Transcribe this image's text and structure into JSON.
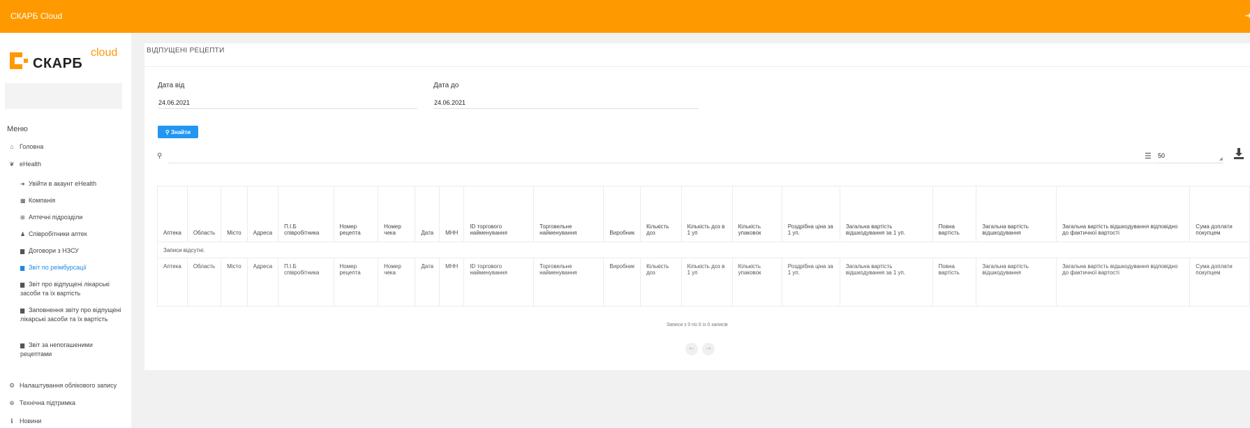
{
  "topbar": {
    "app_title": "СКАРБ Cloud"
  },
  "logo": {
    "word": "СКАРБ",
    "cloud": "cloud"
  },
  "sidebar": {
    "menu_title": "Меню",
    "items": [
      {
        "label": "Головна",
        "icon": "home-icon"
      },
      {
        "label": "eHealth",
        "icon": "leaf-icon"
      }
    ],
    "sub_items": [
      {
        "label": "Увійти в акаунт eHealth",
        "icon": "sign-in-icon"
      },
      {
        "label": "Компанія",
        "icon": "building-icon"
      },
      {
        "label": "Аптечні підрозділи",
        "icon": "plus-square-icon"
      },
      {
        "label": "Співробітники аптек",
        "icon": "users-icon"
      },
      {
        "label": "Договори з НЗСУ",
        "icon": "file-icon"
      },
      {
        "label": "Звіт по реімбурсації",
        "icon": "file-icon",
        "active": true
      },
      {
        "label": "Звіт про відпущені лікарські засоби та їх вартість",
        "icon": "file-icon"
      },
      {
        "label": "Заповнення звіту про відпущені лікарські засоби та їх вартість",
        "icon": "file-icon"
      },
      {
        "label": "Звіт за непогашеними рецептами",
        "icon": "file-icon"
      }
    ],
    "bottom_items": [
      {
        "label": "Налаштування облікового запису",
        "icon": "gear-icon"
      },
      {
        "label": "Технічна підтримка",
        "icon": "lifebuoy-icon"
      },
      {
        "label": "Новини",
        "icon": "info-icon"
      }
    ]
  },
  "page": {
    "title": "ВІДПУЩЕНІ РЕЦЕПТИ"
  },
  "filters": {
    "date_from_label": "Дата від",
    "date_from_value": "24.06.2021",
    "date_to_label": "Дата до",
    "date_to_value": "24.06.2021",
    "find_label": "Знайти"
  },
  "toolbar": {
    "page_size": "50"
  },
  "table": {
    "columns": [
      "Аптека",
      "Область",
      "Місто",
      "Адреса",
      "П.І.Б співробітника",
      "Номер рецепта",
      "Номер чека",
      "Дата",
      "МНН",
      "ID торгового найменування",
      "Торговельне найменування",
      "Виробник",
      "Кількість доз",
      "Кількість доз в 1 уп",
      "Кількість упаковок",
      "Роздрібна ціна за 1 уп.",
      "Загальна вартість відшкодування за 1 уп.",
      "Повна вартість",
      "Загальна вартість відшкодування",
      "Загальна вартість відшкодування відповідно до фактичної вартості",
      "Сума доплати покупцем"
    ],
    "empty_text": "Записи відсутні."
  },
  "summary_text": "Записи з 0 по 0 із 0 записів",
  "pager": {
    "prev": "←",
    "next": "→"
  },
  "colors": {
    "topbar": "#ff9900",
    "accent": "#2196f3",
    "active_link": "#1e88e5"
  }
}
